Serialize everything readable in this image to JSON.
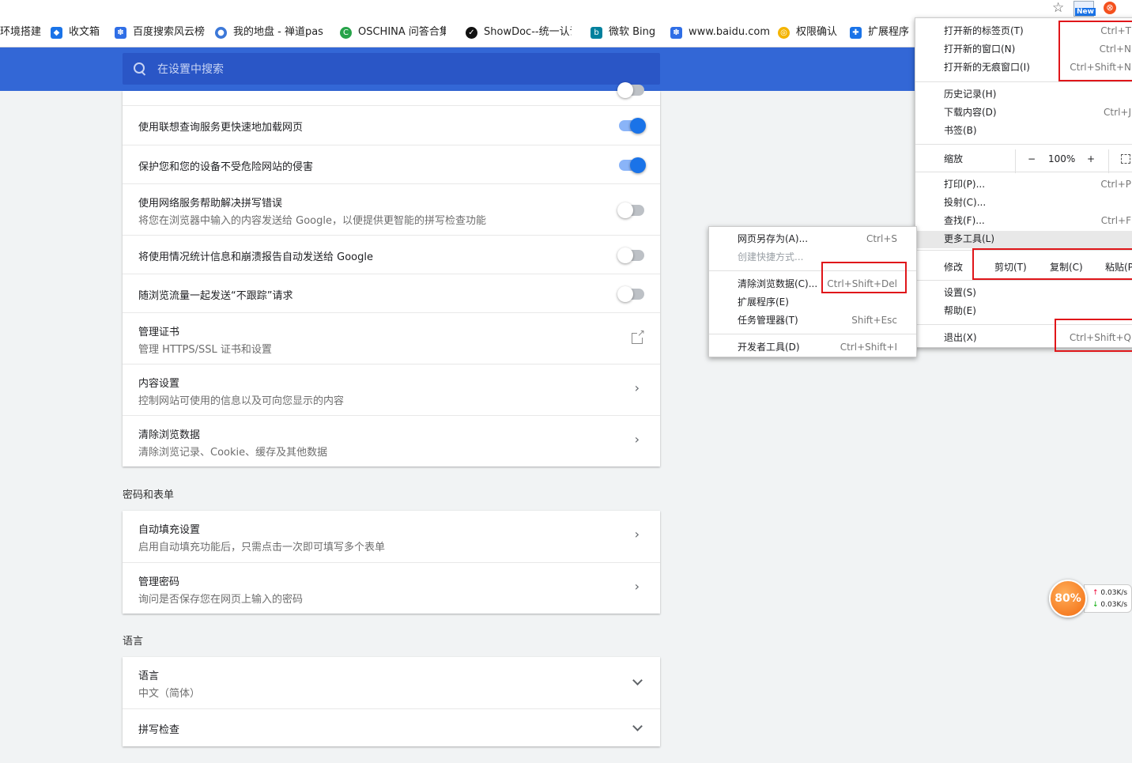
{
  "toolbar": {
    "new_badge": "New"
  },
  "bookmarks": [
    {
      "label": "环境搭建",
      "icon": "none",
      "color": "#ffffff"
    },
    {
      "label": "收文箱",
      "icon": "cube-icon",
      "color": "#1a73e8"
    },
    {
      "label": "百度搜索风云榜",
      "icon": "baidu-paw-icon",
      "color": "#2f6ee6"
    },
    {
      "label": "我的地盘 - 禅道pasl",
      "icon": "globe-icon",
      "color": "#3c78d8"
    },
    {
      "label": "OSCHINA 问答合集",
      "icon": "oschina-icon",
      "color": "#26a349"
    },
    {
      "label": "ShowDoc--统一认证",
      "icon": "showdoc-icon",
      "color": "#111111"
    },
    {
      "label": "微软 Bing",
      "icon": "bing-icon",
      "color": "#00809d"
    },
    {
      "label": "www.baidu.com",
      "icon": "baidu-paw-icon",
      "color": "#2f6ee6"
    },
    {
      "label": "权限确认",
      "icon": "chrome-icon",
      "color": "#f4b400"
    },
    {
      "label": "扩展程序",
      "icon": "puzzle-icon",
      "color": "#1a73e8"
    }
  ],
  "search": {
    "placeholder": "在设置中搜索"
  },
  "privacy_rows": [
    {
      "title": "使用联想查询服务更快速地加载网页",
      "sub": "",
      "control": "toggle-on"
    },
    {
      "title": "保护您和您的设备不受危险网站的侵害",
      "sub": "",
      "control": "toggle-on"
    },
    {
      "title": "使用网络服务帮助解决拼写错误",
      "sub": "将您在浏览器中输入的内容发送给 Google，以便提供更智能的拼写检查功能",
      "control": "toggle-off"
    },
    {
      "title": "将使用情况统计信息和崩溃报告自动发送给 Google",
      "sub": "",
      "control": "toggle-off"
    },
    {
      "title": "随浏览流量一起发送“不跟踪”请求",
      "sub": "",
      "control": "toggle-off"
    },
    {
      "title": "管理证书",
      "sub": "管理 HTTPS/SSL 证书和设置",
      "control": "external"
    },
    {
      "title": "内容设置",
      "sub": "控制网站可使用的信息以及可向您显示的内容",
      "control": "arrow"
    },
    {
      "title": "清除浏览数据",
      "sub": "清除浏览记录、Cookie、缓存及其他数据",
      "control": "arrow"
    }
  ],
  "passwords_section": {
    "title": "密码和表单",
    "rows": [
      {
        "title": "自动填充设置",
        "sub": "启用自动填充功能后，只需点击一次即可填写多个表单"
      },
      {
        "title": "管理密码",
        "sub": "询问是否保存您在网页上输入的密码"
      }
    ]
  },
  "language_section": {
    "title": "语言",
    "rows": [
      {
        "title": "语言",
        "sub": "中文（简体）"
      },
      {
        "title": "拼写检查",
        "sub": ""
      }
    ]
  },
  "main_menu": {
    "items": [
      {
        "label": "打开新的标签页(T)",
        "shortcut": "Ctrl+T"
      },
      {
        "label": "打开新的窗口(N)",
        "shortcut": "Ctrl+N"
      },
      {
        "label": "打开新的无痕窗口(I)",
        "shortcut": "Ctrl+Shift+N"
      },
      {
        "label": "历史记录(H)",
        "shortcut": ""
      },
      {
        "label": "下载内容(D)",
        "shortcut": "Ctrl+J"
      },
      {
        "label": "书签(B)",
        "shortcut": ""
      },
      {
        "label": "打印(P)...",
        "shortcut": "Ctrl+P"
      },
      {
        "label": "投射(C)...",
        "shortcut": ""
      },
      {
        "label": "查找(F)...",
        "shortcut": "Ctrl+F"
      },
      {
        "label": "更多工具(L)",
        "shortcut": ""
      },
      {
        "label": "设置(S)",
        "shortcut": ""
      },
      {
        "label": "帮助(E)",
        "shortcut": ""
      },
      {
        "label": "退出(X)",
        "shortcut": "Ctrl+Shift+Q"
      }
    ],
    "zoom": {
      "label": "缩放",
      "minus": "−",
      "value": "100%",
      "plus": "+"
    },
    "edit": {
      "label": "修改",
      "cut": "剪切(T)",
      "copy": "复制(C)",
      "paste": "粘贴(P)"
    }
  },
  "submenu": {
    "items": [
      {
        "label": "网页另存为(A)...",
        "shortcut": "Ctrl+S",
        "disabled": false
      },
      {
        "label": "创建快捷方式...",
        "shortcut": "",
        "disabled": true
      },
      {
        "label": "清除浏览数据(C)...",
        "shortcut": "Ctrl+Shift+Del",
        "disabled": false
      },
      {
        "label": "扩展程序(E)",
        "shortcut": "",
        "disabled": false
      },
      {
        "label": "任务管理器(T)",
        "shortcut": "Shift+Esc",
        "disabled": false
      },
      {
        "label": "开发者工具(D)",
        "shortcut": "Ctrl+Shift+I",
        "disabled": false
      }
    ]
  },
  "net_widget": {
    "percent": "80%",
    "up": "0.03K/s",
    "down": "0.03K/s"
  },
  "colors": {
    "header_blue": "#3367d6",
    "toggle_blue": "#1a73e8",
    "highlight_red": "#e0161a",
    "widget_orange": "#f26b0f"
  }
}
